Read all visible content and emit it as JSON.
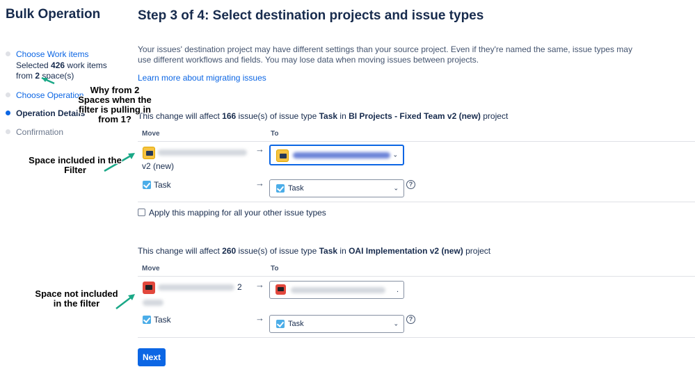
{
  "sidebar": {
    "title": "Bulk Operation",
    "steps": [
      {
        "label": "Choose Work items",
        "state": "link",
        "sub_prefix": "Selected ",
        "sub_count": "426",
        "sub_mid": " work items",
        "sub2_prefix": "from ",
        "sub2_count": "2",
        "sub2_suffix": " space(s)"
      },
      {
        "label": "Choose Operation",
        "state": "link"
      },
      {
        "label": "Operation Details",
        "state": "current"
      },
      {
        "label": "Confirmation",
        "state": "muted"
      }
    ]
  },
  "main": {
    "title": "Step 3 of 4: Select destination projects and issue types",
    "intro": "Your issues' destination project may have different settings than your source project. Even if they're named the same, issue types may use different workflows and fields. You may lose data when moving issues between projects.",
    "learn_more": "Learn more about migrating issues",
    "col_move": "Move",
    "col_to": "To",
    "apply_all": "Apply this mapping for all your other issue types",
    "next": "Next"
  },
  "section1": {
    "prefix": "This change will affect ",
    "count": "166",
    "mid": " issue(s) of issue type ",
    "issue_type": "Task",
    "in": " in ",
    "project": "BI Projects - Fixed Team v2 (new)",
    "suffix": " project",
    "source_tail": "v2 (new)",
    "task_from": "Task",
    "task_to": "Task"
  },
  "section2": {
    "prefix": "This change will affect ",
    "count": "260",
    "mid": " issue(s) of issue type ",
    "issue_type": "Task",
    "in": " in ",
    "project": "OAI Implementation v2 (new)",
    "suffix": " project",
    "source_tail": "2",
    "task_from": "Task",
    "task_to": "Task"
  },
  "annotations": {
    "why": "Why from 2\nSpaces when the\nfilter is pulling in\nfrom 1?",
    "included": "Space included in the\nFilter",
    "not_included": "Space not included\nin the filter"
  },
  "icons": {
    "arrow": "→",
    "chevron": "⌄",
    "help": "?"
  },
  "colors": {
    "link": "#0c66e4",
    "primary_button": "#0c66e4",
    "annotation_arrow": "#1aa887"
  }
}
